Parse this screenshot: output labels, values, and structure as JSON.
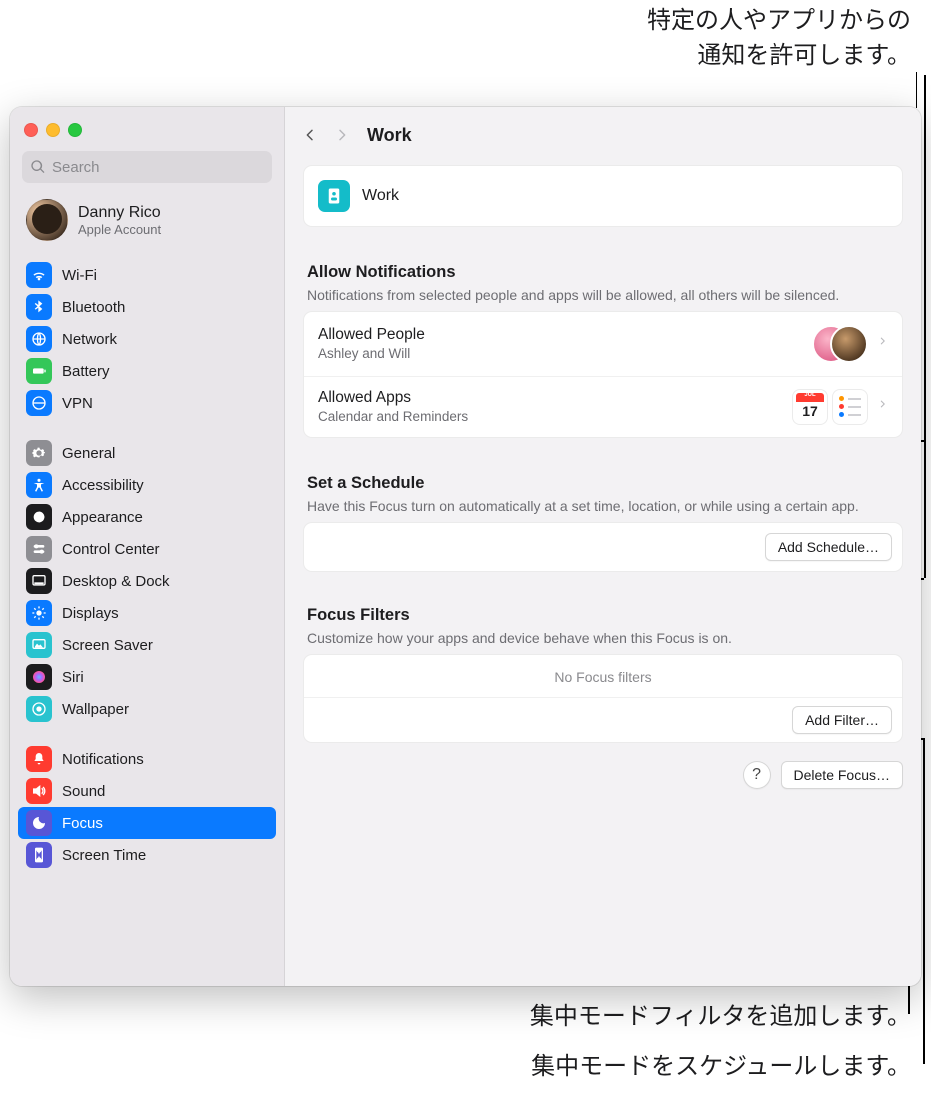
{
  "callouts": {
    "top": "特定の人やアプリからの\n通知を許可します。",
    "bottom1": "集中モードフィルタを追加します。",
    "bottom2": "集中モードをスケジュールします。"
  },
  "search": {
    "placeholder": "Search"
  },
  "account": {
    "name": "Danny Rico",
    "sub": "Apple Account"
  },
  "sidebar_groups": [
    [
      {
        "label": "Wi-Fi",
        "color": "#0a7aff",
        "icon": "wifi"
      },
      {
        "label": "Bluetooth",
        "color": "#0a7aff",
        "icon": "bt"
      },
      {
        "label": "Network",
        "color": "#0a7aff",
        "icon": "net"
      },
      {
        "label": "Battery",
        "color": "#34c759",
        "icon": "bat"
      },
      {
        "label": "VPN",
        "color": "#0a7aff",
        "icon": "vpn"
      }
    ],
    [
      {
        "label": "General",
        "color": "#8e8e93",
        "icon": "gear"
      },
      {
        "label": "Accessibility",
        "color": "#0a7aff",
        "icon": "acc"
      },
      {
        "label": "Appearance",
        "color": "#1c1c1e",
        "icon": "appe"
      },
      {
        "label": "Control Center",
        "color": "#8e8e93",
        "icon": "cc"
      },
      {
        "label": "Desktop & Dock",
        "color": "#1c1c1e",
        "icon": "dock"
      },
      {
        "label": "Displays",
        "color": "#0a7aff",
        "icon": "disp"
      },
      {
        "label": "Screen Saver",
        "color": "#29c3cf",
        "icon": "ssav"
      },
      {
        "label": "Siri",
        "color": "#1c1c1e",
        "icon": "siri"
      },
      {
        "label": "Wallpaper",
        "color": "#29c3cf",
        "icon": "wall"
      }
    ],
    [
      {
        "label": "Notifications",
        "color": "#ff3b30",
        "icon": "bell"
      },
      {
        "label": "Sound",
        "color": "#ff3b30",
        "icon": "snd"
      },
      {
        "label": "Focus",
        "color": "#5856d6",
        "icon": "focus",
        "selected": true
      },
      {
        "label": "Screen Time",
        "color": "#5856d6",
        "icon": "stime"
      }
    ]
  ],
  "header": {
    "title": "Work"
  },
  "focus": {
    "name": "Work"
  },
  "allow": {
    "heading": "Allow Notifications",
    "sub": "Notifications from selected people and apps will be allowed, all others will be silenced.",
    "people_title": "Allowed People",
    "people_sub": "Ashley and Will",
    "apps_title": "Allowed Apps",
    "apps_sub": "Calendar and Reminders",
    "cal_day": "17",
    "cal_mon": "JUL"
  },
  "schedule": {
    "heading": "Set a Schedule",
    "sub": "Have this Focus turn on automatically at a set time, location, or while using a certain app.",
    "button": "Add Schedule…"
  },
  "filters": {
    "heading": "Focus Filters",
    "sub": "Customize how your apps and device behave when this Focus is on.",
    "empty": "No Focus filters",
    "button": "Add Filter…"
  },
  "footer": {
    "delete": "Delete Focus…"
  }
}
